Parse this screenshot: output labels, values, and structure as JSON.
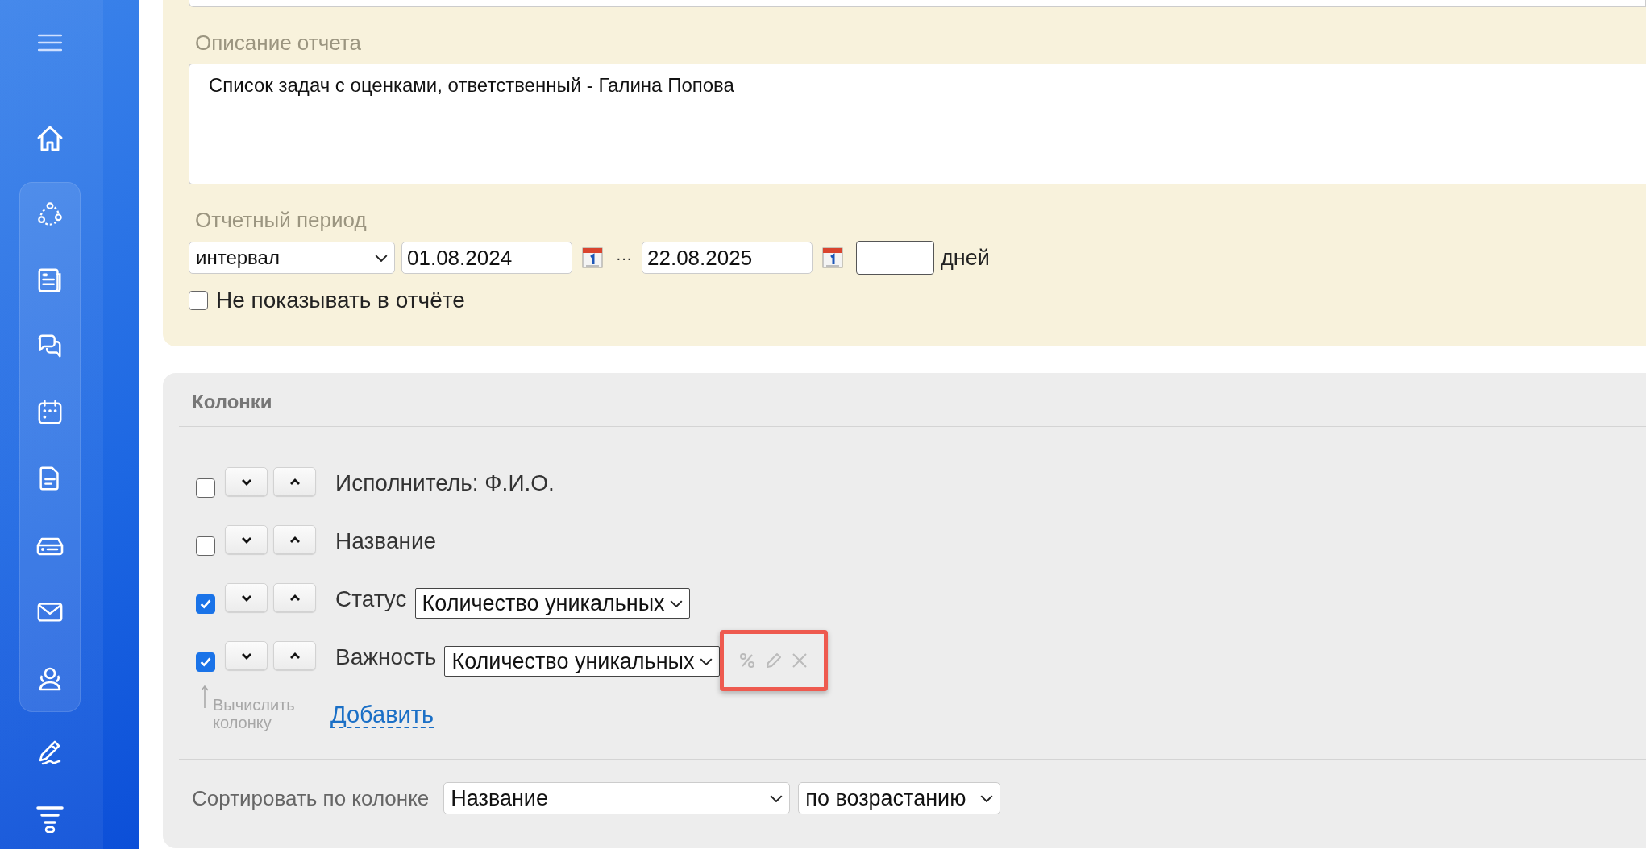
{
  "report_form": {
    "description": {
      "label": "Описание отчета",
      "value": "Список задач с оценками, ответственный - Галина Попова"
    },
    "period": {
      "label": "Отчетный период",
      "mode": "интервал",
      "date_from": "01.08.2024",
      "separator": "···",
      "date_to": "22.08.2025",
      "days_unit": "дней",
      "hide_in_report": {
        "label": "Не показывать в отчёте",
        "checked": false
      }
    }
  },
  "columns": {
    "title": "Колонки",
    "items": [
      {
        "label": "Исполнитель: Ф.И.О.",
        "checked": false
      },
      {
        "label": "Название",
        "checked": false
      },
      {
        "label": "Статус",
        "checked": true,
        "aggregate": "Количество уникальных"
      },
      {
        "label": "Важность",
        "checked": true,
        "aggregate": "Количество уникальных",
        "highlighted": true
      }
    ],
    "compute_hint": "Вычислить колонку",
    "add_link": "Добавить"
  },
  "sort": {
    "label": "Сортировать по колонке",
    "column": "Название",
    "order": "по возрастанию"
  }
}
